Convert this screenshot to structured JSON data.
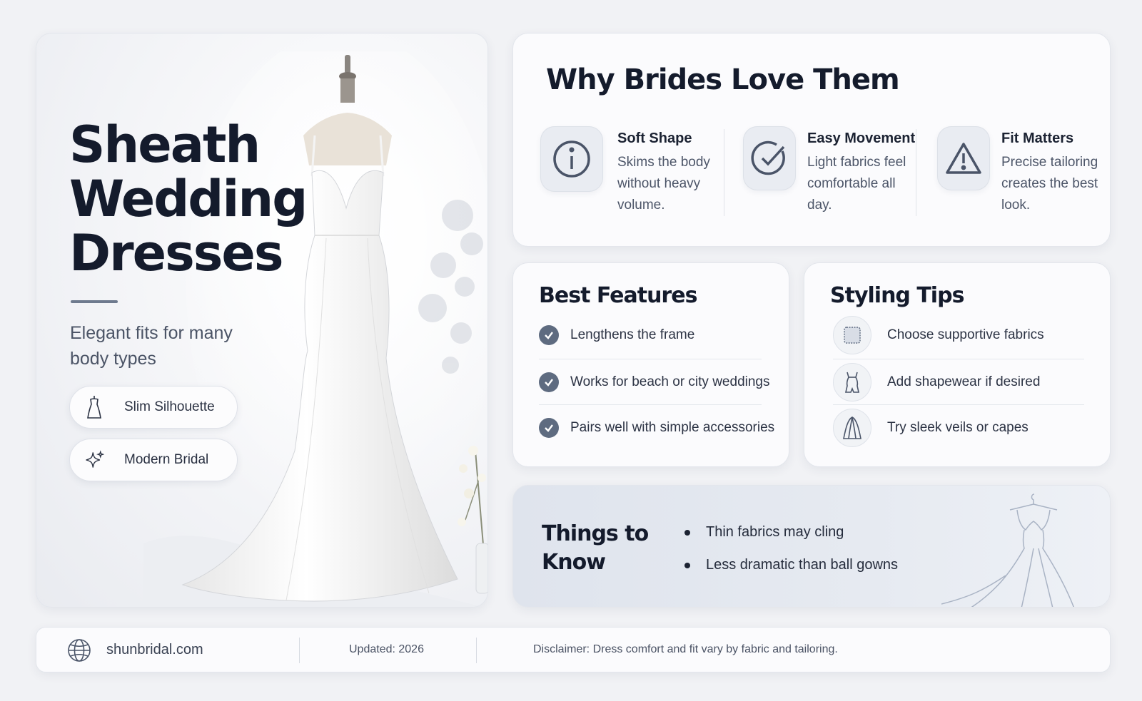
{
  "hero": {
    "title_lines": [
      "Sheath",
      "Wedding",
      "Dresses"
    ],
    "subtitle": "Elegant fits for many body types",
    "pills": [
      {
        "label": "Slim Silhouette",
        "icon": "dress-form-icon"
      },
      {
        "label": "Modern Bridal",
        "icon": "sparkle-icon"
      }
    ]
  },
  "why": {
    "title": "Why Brides Love Them",
    "reasons": [
      {
        "title": "Soft Shape",
        "text": "Skims the body without heavy volume.",
        "icon": "info-icon"
      },
      {
        "title": "Easy Movement",
        "text": "Light fabrics feel comfortable all day.",
        "icon": "check-circle-icon"
      },
      {
        "title": "Fit Matters",
        "text": "Precise tailoring creates the best look.",
        "icon": "warning-icon"
      }
    ]
  },
  "features": {
    "title": "Best Features",
    "items": [
      "Lengthens the frame",
      "Works for beach or city weddings",
      "Pairs well with simple accessories"
    ]
  },
  "tips": {
    "title": "Styling Tips",
    "items": [
      {
        "label": "Choose supportive fabrics",
        "icon": "fabric-swatch-icon"
      },
      {
        "label": "Add shapewear if desired",
        "icon": "shapewear-icon"
      },
      {
        "label": "Try sleek veils or capes",
        "icon": "veil-icon"
      }
    ]
  },
  "know": {
    "title_lines": [
      "Things to",
      "Know"
    ],
    "items": [
      "Thin fabrics may cling",
      "Less dramatic than ball gowns"
    ]
  },
  "footer": {
    "site": "shunbridal.com",
    "updated": "Updated:  2026",
    "disclaimer": "Disclaimer:  Dress comfort and fit vary by fabric and tailoring."
  },
  "colors": {
    "background": "#f1f2f5",
    "heading": "#141b2c",
    "accent": "#5e6b80",
    "know_panel": "#dfe4ed"
  }
}
